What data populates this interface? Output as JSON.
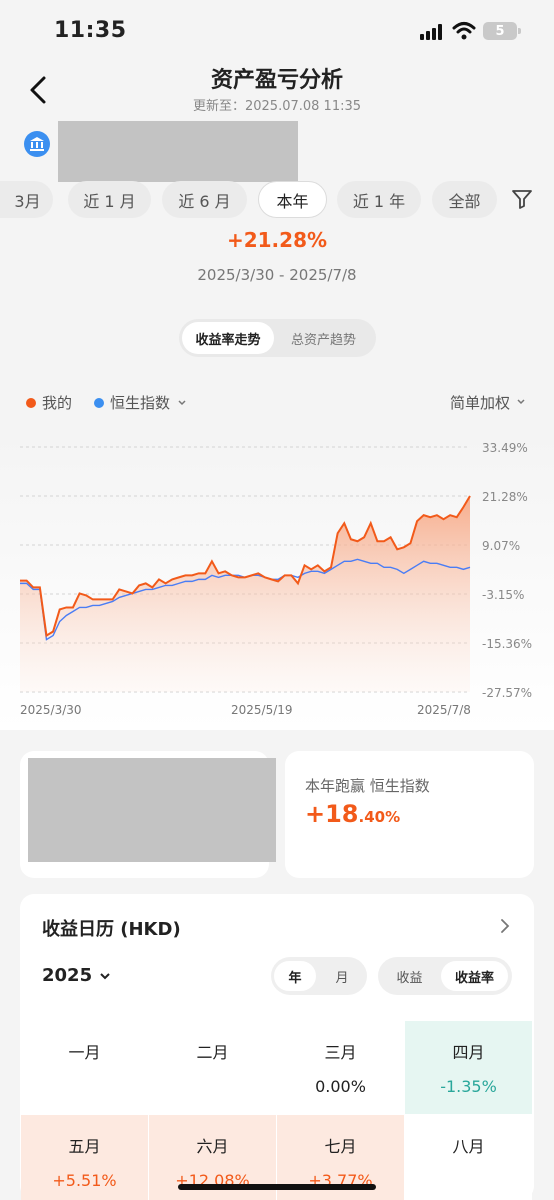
{
  "status_bar": {
    "time": "11:35",
    "battery": "5"
  },
  "header": {
    "title": "资产盈亏分析",
    "updated": "更新至：2025.07.08 11:35"
  },
  "periods": [
    {
      "label": "3月",
      "active": false
    },
    {
      "label": "近 1 月",
      "active": false
    },
    {
      "label": "近 6 月",
      "active": false
    },
    {
      "label": "本年",
      "active": true
    },
    {
      "label": "近 1 年",
      "active": false
    },
    {
      "label": "全部",
      "active": false
    }
  ],
  "summary": {
    "return": "+21.28%",
    "date_range": "2025/3/30 - 2025/7/8"
  },
  "view_toggle": {
    "yield_trend": "收益率走势",
    "asset_trend": "总资产趋势"
  },
  "legend": {
    "mine": "我的",
    "index": "恒生指数",
    "weighting": "简单加权"
  },
  "colors": {
    "mine": "#f25a1a",
    "index": "#4a7df5",
    "positive": "#f25a1a",
    "negative": "#2aa79b"
  },
  "chart_data": {
    "type": "line",
    "y_ticks": [
      "33.49%",
      "21.28%",
      "9.07%",
      "-3.15%",
      "-15.36%",
      "-27.57%"
    ],
    "ylim": [
      -27.57,
      33.49
    ],
    "x_tick_labels": [
      "2025/3/30",
      "2025/5/19",
      "2025/7/8"
    ],
    "series": [
      {
        "name": "我的",
        "values": [
          0.2,
          0.2,
          -1.5,
          -1.5,
          -13.5,
          -12.5,
          -7.0,
          -6.5,
          -6.5,
          -3.0,
          -3.5,
          -4.5,
          -4.5,
          -4.5,
          -4.5,
          -2.0,
          -2.5,
          -3.0,
          -1.0,
          -0.5,
          -1.5,
          0.5,
          -0.5,
          0.5,
          1.0,
          1.5,
          1.5,
          2.0,
          2.0,
          5.0,
          2.0,
          2.5,
          1.5,
          1.0,
          1.0,
          1.5,
          2.0,
          1.0,
          0.5,
          0.0,
          1.5,
          1.5,
          -0.5,
          4.0,
          3.0,
          4.0,
          2.5,
          3.5,
          12.0,
          14.5,
          10.5,
          10.0,
          11.0,
          14.5,
          10.0,
          10.0,
          11.0,
          8.0,
          8.5,
          9.5,
          15.0,
          16.5,
          16.0,
          16.5,
          15.5,
          16.5,
          16.0,
          18.5,
          21.28
        ]
      },
      {
        "name": "恒生指数",
        "values": [
          -0.5,
          -0.5,
          -2.0,
          -2.0,
          -14.5,
          -13.5,
          -10.0,
          -8.5,
          -7.5,
          -6.5,
          -6.5,
          -6.0,
          -6.0,
          -5.5,
          -5.0,
          -4.0,
          -3.5,
          -3.0,
          -2.5,
          -2.0,
          -2.0,
          -1.5,
          -1.0,
          -1.0,
          -0.5,
          0.0,
          0.0,
          0.5,
          0.5,
          1.5,
          1.0,
          1.5,
          1.5,
          1.5,
          1.0,
          1.5,
          1.5,
          1.0,
          0.5,
          0.5,
          1.5,
          1.5,
          1.0,
          2.0,
          2.5,
          2.5,
          2.0,
          3.0,
          4.0,
          5.0,
          5.0,
          5.5,
          5.0,
          4.5,
          4.5,
          3.5,
          3.5,
          3.0,
          2.0,
          3.0,
          4.0,
          5.0,
          4.5,
          4.5,
          4.0,
          3.5,
          3.5,
          3.0,
          3.5
        ]
      }
    ]
  },
  "outperform": {
    "label": "本年跑赢 恒生指数",
    "value_big": "+18",
    "value_small": ".40%"
  },
  "calendar": {
    "title": "收益日历 (HKD)",
    "year": "2025",
    "mode_year": "年",
    "mode_month": "月",
    "metric_amount": "收益",
    "metric_rate": "收益率",
    "months": [
      {
        "name": "一月",
        "value": "",
        "tone": "none"
      },
      {
        "name": "二月",
        "value": "",
        "tone": "none"
      },
      {
        "name": "三月",
        "value": "0.00%",
        "tone": "zero"
      },
      {
        "name": "四月",
        "value": "-1.35%",
        "tone": "neg"
      },
      {
        "name": "五月",
        "value": "+5.51%",
        "tone": "pos"
      },
      {
        "name": "六月",
        "value": "+12.08%",
        "tone": "pos"
      },
      {
        "name": "七月",
        "value": "+3.77%",
        "tone": "pos"
      },
      {
        "name": "八月",
        "value": "",
        "tone": "none"
      }
    ]
  }
}
